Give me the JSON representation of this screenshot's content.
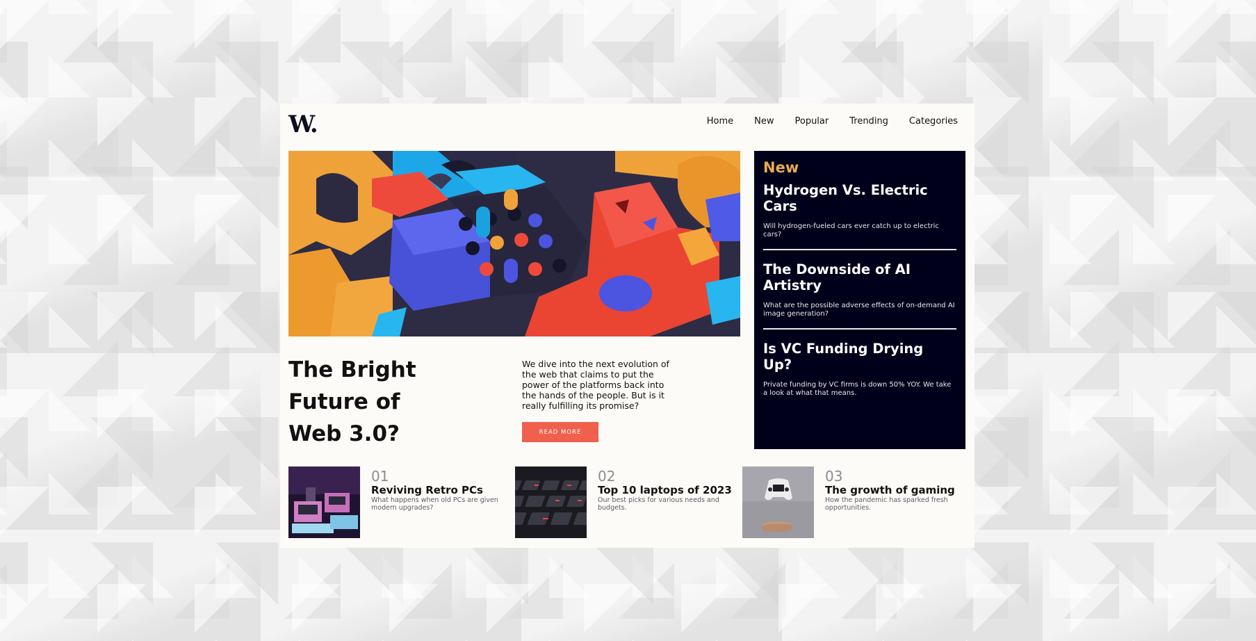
{
  "header": {
    "logo": "W.",
    "nav": [
      "Home",
      "New",
      "Popular",
      "Trending",
      "Categories"
    ]
  },
  "hero": {
    "image_alt": "3D colorful geometric blocks",
    "title": "The Bright Future of Web 3.0?",
    "description": "We dive into the next evolution of the web that claims to put the power of the platforms back into the hands of the people. But is it really fulfilling its promise?",
    "cta": "READ MORE"
  },
  "sidebar": {
    "heading": "New",
    "items": [
      {
        "title": "Hydrogen Vs. Electric Cars",
        "desc": "Will hydrogen-fueled cars ever catch up to electric cars?"
      },
      {
        "title": "The Downside of AI Artistry",
        "desc": "What are the possible adverse effects of on-demand AI image generation?"
      },
      {
        "title": "Is VC Funding Drying Up?",
        "desc": "Private funding by VC firms is down 50% YOY. We take a look at what that means."
      }
    ]
  },
  "articles": [
    {
      "num": "01",
      "title": "Reviving Retro PCs",
      "desc": "What happens when old PCs are given modern upgrades?"
    },
    {
      "num": "02",
      "title": "Top 10 laptops of 2023",
      "desc": "Our best picks for various needs and budgets."
    },
    {
      "num": "03",
      "title": "The growth of gaming",
      "desc": "How the pandemic has sparked fresh opportunities."
    }
  ],
  "colors": {
    "accent": "#f0604c",
    "sidebar_bg": "#00001a",
    "sidebar_heading": "#e9ab53",
    "card_bg": "#fdfbf7"
  }
}
